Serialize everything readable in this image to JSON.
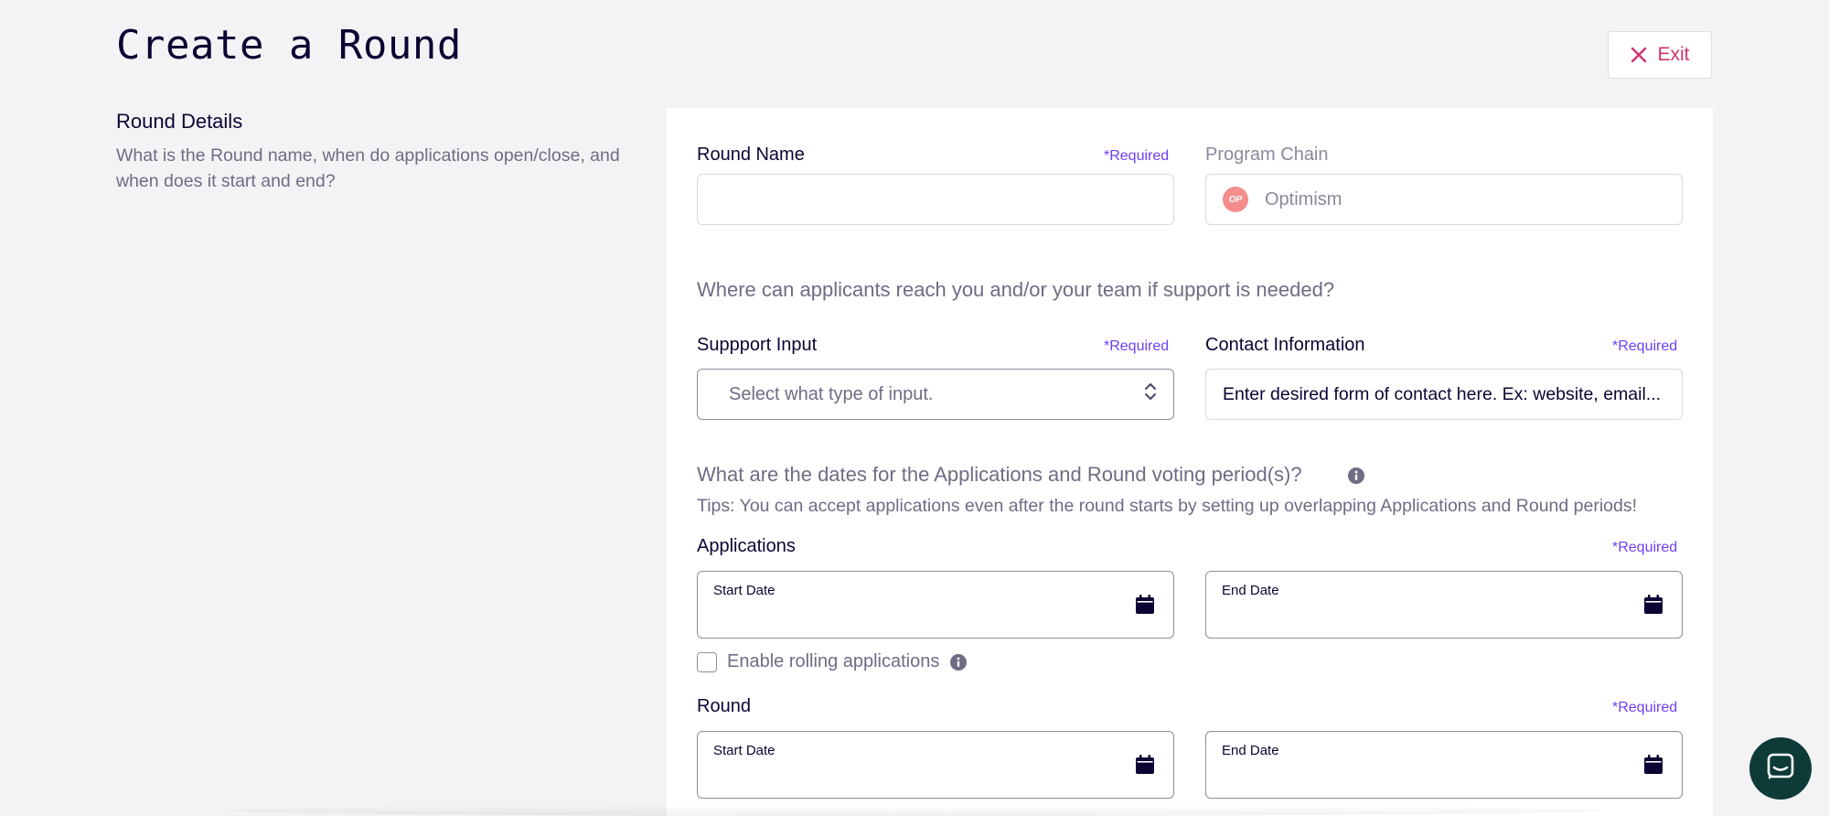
{
  "header": {
    "title": "Create a Round",
    "exit_label": "Exit"
  },
  "section": {
    "heading": "Round Details",
    "description": "What is the Round name, when do applications open/close, and when does it start and end?"
  },
  "form": {
    "round_name": {
      "label": "Round Name",
      "required": "*Required",
      "value": ""
    },
    "program_chain": {
      "label": "Program Chain",
      "badge": "OP",
      "value": "Optimism"
    },
    "support_question": "Where can applicants reach you and/or your team if support is needed?",
    "support_input": {
      "label": "Suppport Input",
      "required": "*Required",
      "placeholder": "Select what type of input."
    },
    "contact_information": {
      "label": "Contact Information",
      "required": "*Required",
      "placeholder": "Enter desired form of contact here. Ex: website, email..."
    },
    "dates_question": "What are the dates for the Applications and Round voting period(s)?",
    "dates_tips": "Tips: You can accept applications even after the round starts by setting up overlapping Applications and Round periods!",
    "applications": {
      "label": "Applications",
      "required": "*Required",
      "start_label": "Start Date",
      "end_label": "End Date"
    },
    "rolling": {
      "label": "Enable rolling applications",
      "checked": false
    },
    "round": {
      "label": "Round",
      "required": "*Required",
      "start_label": "Start Date",
      "end_label": "End Date"
    }
  },
  "colors": {
    "accent_required": "#6f3ff5",
    "exit": "#d0326b",
    "chat": "#0e3b38",
    "op_badge": "#f68d8d"
  },
  "icons": {
    "exit": "close-icon",
    "chevrons": "chevron-up-down-icon",
    "calendar": "calendar-icon",
    "info": "info-icon",
    "chat": "chat-icon"
  }
}
